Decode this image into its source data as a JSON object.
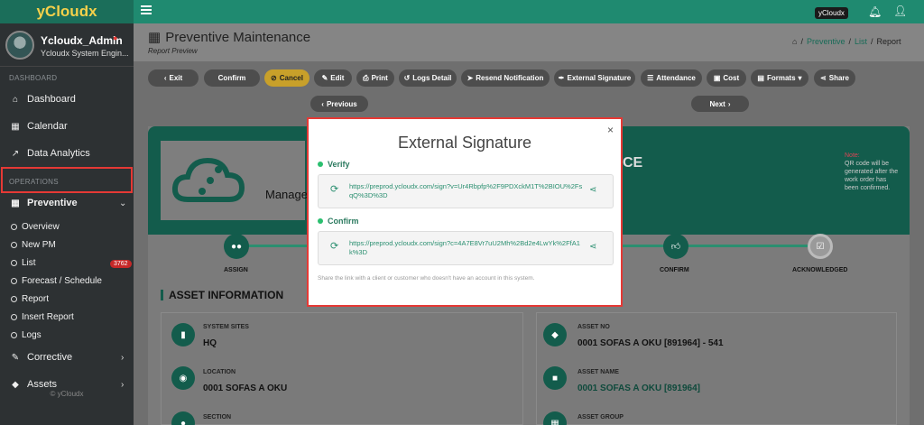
{
  "brand": "yCloudx",
  "topbar": {
    "tag": "yCloudx",
    "bell_icon": "bell-icon",
    "user_icon": "user-icon"
  },
  "sidebar": {
    "user": {
      "name": "Ycloudx_Admin",
      "role": "Ycloudx System Engin..."
    },
    "sections": {
      "dashboard": "DASHBOARD",
      "operations": "OPERATIONS"
    },
    "items": {
      "dashboard": "Dashboard",
      "calendar": "Calendar",
      "analytics": "Data Analytics",
      "preventive": "Preventive",
      "corrective": "Corrective",
      "assets": "Assets"
    },
    "preventive_sub": {
      "overview": "Overview",
      "new_pm": "New PM",
      "list": "List",
      "list_badge": "3762",
      "forecast": "Forecast / Schedule",
      "report": "Report",
      "insert_report": "Insert Report",
      "logs": "Logs"
    },
    "footer": "© yCloudx"
  },
  "page": {
    "title": "Preventive Maintenance",
    "subtitle": "Report Preview",
    "breadcrumb": {
      "home": "⌂",
      "sep": "/",
      "preventive": "Preventive",
      "list": "List",
      "report": "Report"
    }
  },
  "toolbar": {
    "exit": "Exit",
    "confirm": "Confirm",
    "cancel": "Cancel",
    "edit": "Edit",
    "print": "Print",
    "logs_detail": "Logs Detail",
    "resend": "Resend Notification",
    "external_signature": "External Signature",
    "attendance": "Attendance",
    "cost": "Cost",
    "formats": "Formats",
    "share": "Share"
  },
  "pager": {
    "previous": "Previous",
    "next": "Next"
  },
  "header_card": {
    "company": "Manage",
    "heading_part": "CE",
    "note_label": "Note:",
    "note": "QR code will be generated after the work order has been confirmed."
  },
  "steps": {
    "assign": "ASSIGN",
    "confirm": "CONFIRM",
    "acknowledged": "ACKNOWLEDGED"
  },
  "asset_info": {
    "heading": "ASSET INFORMATION",
    "system_sites_label": "SYSTEM SITES",
    "system_sites": "HQ",
    "location_label": "LOCATION",
    "location": "0001 SOFAS A OKU",
    "section_label": "SECTION",
    "asset_no_label": "ASSET NO",
    "asset_no": "0001 SOFAS A OKU [891964] - 541",
    "asset_name_label": "ASSET NAME",
    "asset_name": "0001 SOFAS A OKU [891964]",
    "asset_group_label": "ASSET GROUP"
  },
  "modal": {
    "title": "External Signature",
    "verify_label": "Verify",
    "verify_link": "https://preprod.ycloudx.com/sign?v=Ur4Rbpfp%2F9PDXckM1T%2BIOU%2FsqQ%3D%3D",
    "confirm_label": "Confirm",
    "confirm_link": "https://preprod.ycloudx.com/sign?c=4A7E8Vr7uU2Mh%2Bd2e4LwYk%2FfA1k%3D",
    "note": "Share the link with a client or customer who doesn't have an account in this system.",
    "close": "×"
  },
  "colors": {
    "accent": "#1f8a70",
    "highlight": "#e53935",
    "sidebar": "#2d3133"
  }
}
